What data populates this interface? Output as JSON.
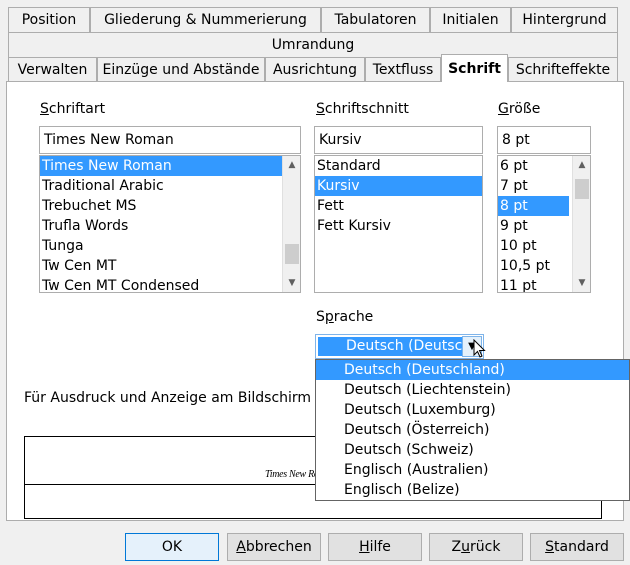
{
  "tabs_row1": [
    "Position",
    "Gliederung & Nummerierung",
    "Tabulatoren",
    "Initialen",
    "Hintergrund"
  ],
  "tabs_row2": [
    "Umrandung"
  ],
  "tabs_row3": [
    "Verwalten",
    "Einzüge und Abstände",
    "Ausrichtung",
    "Textfluss",
    "Schrift",
    "Schrifteffekte"
  ],
  "active_tab": "Schrift",
  "font": {
    "label_first": "S",
    "label_rest": "chriftart",
    "value": "Times New Roman",
    "list": [
      "Times New Roman",
      "Traditional Arabic",
      "Trebuchet MS",
      "Trufla Words",
      "Tunga",
      "Tw Cen MT",
      "Tw Cen MT Condensed"
    ],
    "selected_index": 0
  },
  "style": {
    "label_first": "S",
    "label_mid": "c",
    "label_rest": "hriftschnitt",
    "value": "Kursiv",
    "list": [
      "Standard",
      "Kursiv",
      "Fett",
      "Fett Kursiv"
    ],
    "selected_index": 1
  },
  "size": {
    "label_first": "G",
    "label_rest": "röße",
    "value": "8 pt",
    "list": [
      "6 pt",
      "7 pt",
      "8 pt",
      "9 pt",
      "10 pt",
      "10,5 pt",
      "11 pt"
    ],
    "selected_index": 2
  },
  "language": {
    "label_pre": "S",
    "label_u": "p",
    "label_rest": "rache",
    "value": "Deutsch (Deutschland)",
    "options": [
      "Deutsch (Deutschland)",
      "Deutsch (Liechtenstein)",
      "Deutsch (Luxemburg)",
      "Deutsch (Österreich)",
      "Deutsch (Schweiz)",
      "Englisch (Australien)",
      "Englisch (Belize)"
    ],
    "selected_index": 0
  },
  "info_text": "Für Ausdruck und Anzeige am Bildschirm wi",
  "preview_text": "Times New Roman",
  "buttons": {
    "ok": "OK",
    "cancel_u": "A",
    "cancel_rest": "bbrechen",
    "help_u": "H",
    "help_rest": "ilfe",
    "back_pre": "Z",
    "back_u": "u",
    "back_rest": "rück",
    "standard_u": "S",
    "standard_rest": "tandard"
  },
  "colors": {
    "selection": "#3399ff",
    "background": "#f0f0f0",
    "panel": "#ffffff"
  }
}
